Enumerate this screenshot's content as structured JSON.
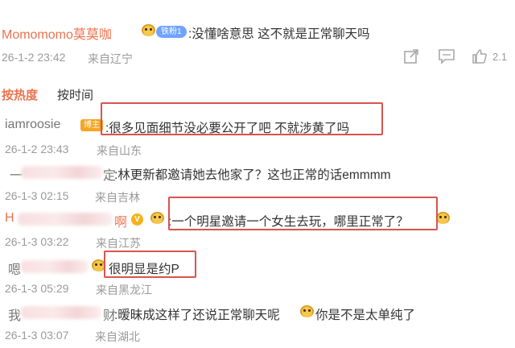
{
  "top_comment": {
    "username": "Momomomo莫莫咖",
    "badge": "铁粉1",
    "text": ":没懂啥意思 这不就是正常聊天吗",
    "time": "26-1-2 23:42",
    "location": "来自辽宁",
    "like_count": "2.1"
  },
  "sort_tabs": {
    "hot": "按热度",
    "time": "按时间"
  },
  "replies": [
    {
      "username": "iamroosie",
      "badge": "博主",
      "text": ":很多见面细节没必要公开了吧 不就涉黄了吗",
      "time": "26-1-2 23:43",
      "location": "来自山东"
    },
    {
      "username_prefix": "一",
      "username_suffix": "定",
      "text": ":林更新都邀请她去他家了？这也正常的话emmmm",
      "time": "26-1-3 02:15",
      "location": "来自吉林"
    },
    {
      "username_prefix": "H",
      "username_suffix": "啊",
      "text": ":一个明星邀请一个女生去玩，哪里正常了？",
      "time": "26-1-3 03:22",
      "location": "来自江苏"
    },
    {
      "username_prefix": "嗯",
      "username_suffix": "",
      "text": "很明显是约P",
      "time": "26-1-3 05:29",
      "location": "来自黑龙江"
    },
    {
      "username_prefix": "我",
      "username_suffix": "财",
      "text": ":暧昧成这样了还说正常聊天呢",
      "text2": "你是不是太单纯了",
      "time": "26-1-3 03:07",
      "location": "来自湖北"
    }
  ]
}
